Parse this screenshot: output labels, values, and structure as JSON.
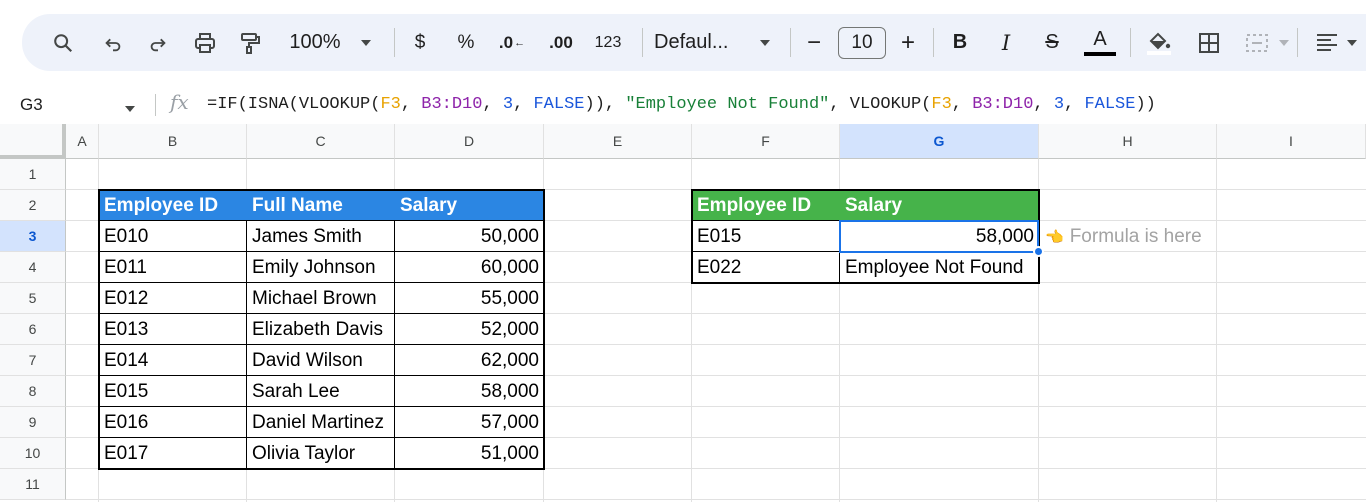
{
  "toolbar": {
    "zoom": "100%",
    "currency": "$",
    "percent": "%",
    "dec_decrease": ".0",
    "dec_increase": ".00",
    "number_format": "123",
    "font": "Defaul...",
    "font_size": "10",
    "minus": "−",
    "plus": "+",
    "bold": "B",
    "italic": "I",
    "strike": "S",
    "text_color": "A",
    "icons": [
      "search-icon",
      "undo-icon",
      "redo-icon",
      "print-icon",
      "paint-format-icon",
      "dropdown-icon",
      "text-color-icon",
      "fill-color-icon",
      "borders-icon",
      "merge-icon",
      "align-icon"
    ]
  },
  "formula_bar": {
    "name_box": "G3",
    "fx": "fx",
    "formula_parts": {
      "p1": "=IF(ISNA(VLOOKUP(",
      "r1": "F3",
      "s1": ", ",
      "r2": "B3:D10",
      "s2": ", ",
      "n1": "3",
      "s3": ", ",
      "b1": "FALSE",
      "s4": ")), ",
      "str": "\"Employee Not Found\"",
      "s5": ", VLOOKUP(",
      "r3": "F3",
      "s6": ", ",
      "r4": "B3:D10",
      "s7": ", ",
      "n2": "3",
      "s8": ", ",
      "b2": "FALSE",
      "s9": "))"
    }
  },
  "columns": [
    "A",
    "B",
    "C",
    "D",
    "E",
    "F",
    "G",
    "H",
    "I"
  ],
  "rows": [
    "1",
    "2",
    "3",
    "4",
    "5",
    "6",
    "7",
    "8",
    "9",
    "10",
    "11"
  ],
  "selected": {
    "column": "G",
    "row": "3"
  },
  "left_table": {
    "headers": [
      "Employee ID",
      "Full Name",
      "Salary"
    ],
    "rows": [
      [
        "E010",
        "James Smith",
        "50,000"
      ],
      [
        "E011",
        "Emily Johnson",
        "60,000"
      ],
      [
        "E012",
        "Michael Brown",
        "55,000"
      ],
      [
        "E013",
        "Elizabeth Davis",
        "52,000"
      ],
      [
        "E014",
        "David Wilson",
        "62,000"
      ],
      [
        "E015",
        "Sarah Lee",
        "58,000"
      ],
      [
        "E016",
        "Daniel Martinez",
        "57,000"
      ],
      [
        "E017",
        "Olivia Taylor",
        "51,000"
      ]
    ]
  },
  "right_table": {
    "headers": [
      "Employee ID",
      "Salary"
    ],
    "rows": [
      [
        "E015",
        "58,000"
      ],
      [
        "E022",
        "Employee Not Found"
      ]
    ]
  },
  "annotation": {
    "icon": "👈",
    "text": "Formula is here"
  },
  "colors": {
    "left_header_bg": "#2b86e3",
    "right_header_bg": "#46b34a",
    "selection": "#1a73e8",
    "toolbar_bg": "#eef2fa"
  }
}
